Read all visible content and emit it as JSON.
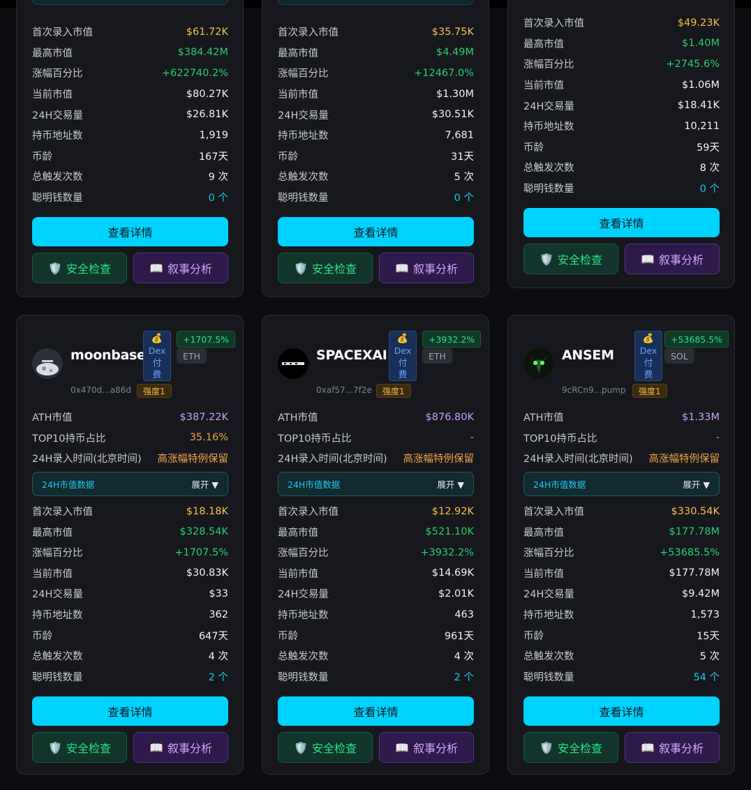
{
  "labels": {
    "ath_mcap": "ATH市值",
    "top10_share": "TOP10持币占比",
    "record_time_24h": "24H录入时间(北京时间)",
    "section_24h": "24H市值数据",
    "expand": "展开 ▼",
    "first_mcap": "首次录入市值",
    "max_mcap": "最高市值",
    "gain_pct": "涨幅百分比",
    "current_mcap": "当前市值",
    "volume_24h": "24H交易量",
    "holders": "持币地址数",
    "age": "币龄",
    "triggers": "总触发次数",
    "smart_money": "聪明钱数量",
    "view_details": "查看详情",
    "security_check": "安全检查",
    "narrative_analysis": "叙事分析",
    "security_icon": "🛡️",
    "narrative_icon": "📖",
    "dex_coin": "💰",
    "dex_l1": "Dex",
    "dex_l2": "付",
    "dex_l3": "费"
  },
  "top_cards": [
    {
      "first": "$61.72K",
      "max": "$384.42M",
      "gain": "+622740.2%",
      "current": "$80.27K",
      "volume": "$26.81K",
      "holders": "1,919",
      "age": "167天",
      "triggers": "9 次",
      "smart": "0 个"
    },
    {
      "first": "$35.75K",
      "max": "$4.49M",
      "gain": "+12467.0%",
      "current": "$1.30M",
      "volume": "$30.51K",
      "holders": "7,681",
      "age": "31天",
      "triggers": "5 次",
      "smart": "0 个"
    },
    {
      "first": "$49.23K",
      "max": "$1.40M",
      "gain": "+2745.6%",
      "current": "$1.06M",
      "volume": "$18.41K",
      "holders": "10,211",
      "age": "59天",
      "triggers": "8 次",
      "smart": "0 个"
    }
  ],
  "bottom_cards": [
    {
      "name": "moonbase",
      "avatar": "moonbase-avatar",
      "pct": "+1707.5%",
      "chain": "ETH",
      "addr": "0x470d...a86d",
      "strength": "强度1",
      "ath": "$387.22K",
      "top10": "35.16%",
      "record": "高涨幅特例保留",
      "first": "$18.18K",
      "max": "$328.54K",
      "gain": "+1707.5%",
      "current": "$30.83K",
      "volume": "$33",
      "holders": "362",
      "age": "647天",
      "triggers": "4 次",
      "smart": "2 个"
    },
    {
      "name": "SPACEXAI",
      "avatar": "spacexai-avatar",
      "pct": "+3932.2%",
      "chain": "ETH",
      "addr": "0xaf57...7f2e",
      "strength": "强度1",
      "ath": "$876.80K",
      "top10": "-",
      "record": "高涨幅特例保留",
      "first": "$12.92K",
      "max": "$521.10K",
      "gain": "+3932.2%",
      "current": "$14.69K",
      "volume": "$2.01K",
      "holders": "463",
      "age": "961天",
      "triggers": "4 次",
      "smart": "2 个"
    },
    {
      "name": "ANSEM",
      "avatar": "ansem-avatar",
      "pct": "+53685.5%",
      "chain": "SOL",
      "addr": "9cRCn9...pump",
      "strength": "强度1",
      "ath": "$1.33M",
      "top10": "-",
      "record": "高涨幅特例保留",
      "first": "$330.54K",
      "max": "$177.78M",
      "gain": "+53685.5%",
      "current": "$177.78M",
      "volume": "$9.42M",
      "holders": "1,573",
      "age": "15天",
      "triggers": "5 次",
      "smart": "54 个"
    }
  ],
  "colors": {
    "accent": "#00d2ff",
    "gain": "#2ecc71",
    "first": "#f6c04b",
    "ath": "#c9a0ff",
    "record": "#f0a247",
    "smart": "#22c7f2"
  }
}
